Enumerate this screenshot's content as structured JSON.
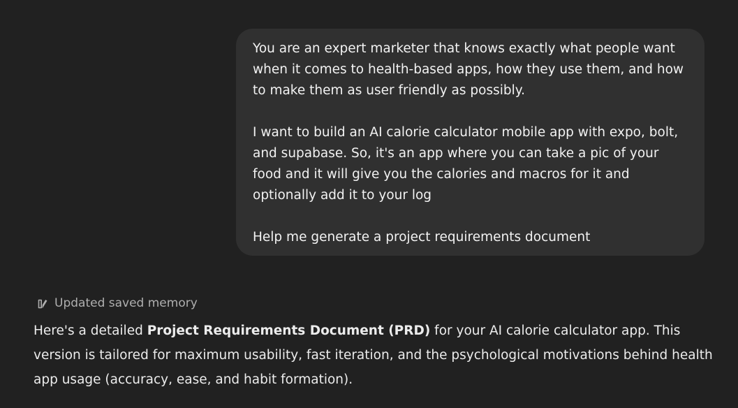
{
  "user_message": {
    "paragraphs": [
      "You are an expert marketer that knows exactly what people want when it comes to health-based apps, how they use them, and how to make them as user friendly as possibly.",
      "I want to build an AI calorie calculator mobile app with expo, bolt, and supabase. So, it's an app where you can take a pic of your food and it will give you the calories and macros for it and optionally add it to your log",
      "Help me generate a project requirements document"
    ]
  },
  "memory_status": {
    "icon": "memory-pen-icon",
    "label": "Updated saved memory"
  },
  "assistant_message": {
    "intro_before": "Here's a detailed ",
    "intro_bold": "Project Requirements Document (PRD)",
    "intro_after": " for your AI calorie calculator app. This version is tailored for maximum usability, fast iteration, and the psychological motivations behind health app usage (accuracy, ease, and habit formation)."
  },
  "colors": {
    "background": "#212121",
    "user_bubble": "#303030",
    "text": "#ececec",
    "muted_text": "#afafaf"
  }
}
